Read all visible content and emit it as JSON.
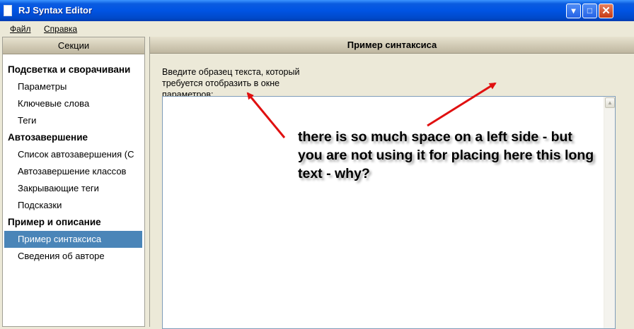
{
  "window": {
    "title": "RJ Syntax Editor",
    "controls": {
      "minimize": "▾",
      "maximize": "□",
      "close": "✕"
    }
  },
  "menu": {
    "items": [
      {
        "label": "Файл"
      },
      {
        "label": "Справка"
      }
    ]
  },
  "sidebar": {
    "header": "Секции",
    "groups": [
      {
        "label": "Подсветка и сворачивани",
        "items": [
          "Параметры",
          "Ключевые слова",
          "Теги"
        ]
      },
      {
        "label": "Автозавершение",
        "items": [
          "Список автозавершения (С",
          "Автозавершение классов",
          "Закрывающие теги",
          "Подсказки"
        ]
      },
      {
        "label": "Пример и описание",
        "items": [
          "Пример синтаксиса",
          "Сведения об авторе"
        ]
      }
    ],
    "selected": "Пример синтаксиса"
  },
  "main": {
    "header": "Пример синтаксиса",
    "description": "Введите образец текста, который требуется отобразить в окне параметров:",
    "sample_text": ""
  },
  "annotation": {
    "text": "there is so much space on a left side - but you are not using it for placing here this long text - why?",
    "arrow_color": "#e01010"
  },
  "icons": {
    "app": "document-icon",
    "scroll_up": "scroll-up-arrow-icon"
  }
}
